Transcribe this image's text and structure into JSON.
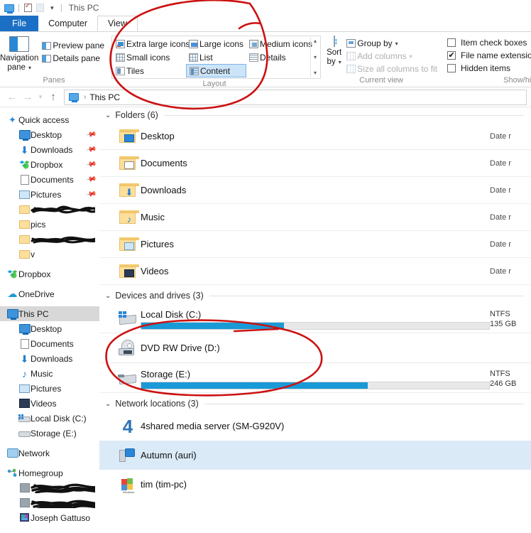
{
  "window": {
    "title": "This PC",
    "icon": "computer-icon",
    "quick_access_toolbar": [
      "properties-icon",
      "new-folder-icon",
      "customize-caret"
    ]
  },
  "ribbon": {
    "tabs": [
      {
        "label": "File",
        "type": "file"
      },
      {
        "label": "Computer",
        "type": "normal"
      },
      {
        "label": "View",
        "type": "active"
      }
    ],
    "groups": [
      {
        "name": "Panes",
        "label": "Panes",
        "big_button": {
          "label_line1": "Navigation",
          "label_line2": "pane",
          "caret": "▾",
          "icon": "navigation-pane-icon"
        },
        "small_buttons": [
          {
            "label": "Preview pane",
            "icon": "preview-pane-icon",
            "disabled": false
          },
          {
            "label": "Details pane",
            "icon": "details-pane-icon",
            "disabled": false
          }
        ]
      },
      {
        "name": "Layout",
        "label": "Layout",
        "gallery": [
          {
            "label": "Extra large icons",
            "icon": "extra-large-icons-icon",
            "selected": false
          },
          {
            "label": "Large icons",
            "icon": "large-icons-icon",
            "selected": false
          },
          {
            "label": "Medium icons",
            "icon": "medium-icons-icon",
            "selected": false
          },
          {
            "label": "Small icons",
            "icon": "small-icons-icon",
            "selected": false
          },
          {
            "label": "List",
            "icon": "list-view-icon",
            "selected": false
          },
          {
            "label": "Details",
            "icon": "details-view-icon",
            "selected": false
          },
          {
            "label": "Tiles",
            "icon": "tiles-view-icon",
            "selected": false
          },
          {
            "label": "Content",
            "icon": "content-view-icon",
            "selected": true
          }
        ],
        "scroll": {
          "up": "▴",
          "down": "▾",
          "more": "▾"
        }
      },
      {
        "name": "Current view",
        "label": "Current view",
        "big_button": {
          "label_line1": "Sort",
          "label_line2": "by",
          "caret": "▾",
          "icon": "sort-by-icon"
        },
        "small_buttons": [
          {
            "label": "Group by",
            "icon": "group-by-icon",
            "caret": "▾",
            "disabled": false
          },
          {
            "label": "Add columns",
            "icon": "add-columns-icon",
            "caret": "▾",
            "disabled": true
          },
          {
            "label": "Size all columns to fit",
            "icon": "size-columns-icon",
            "disabled": true
          }
        ]
      },
      {
        "name": "Show/hide",
        "label": "Show/hid",
        "checkboxes": [
          {
            "label": "Item check boxes",
            "checked": false
          },
          {
            "label": "File name extension",
            "checked": true
          },
          {
            "label": "Hidden items",
            "checked": false
          }
        ]
      }
    ]
  },
  "addressbar": {
    "back": "←",
    "forward": "→",
    "recent": "▾",
    "up": "↑",
    "breadcrumb_icon": "computer-icon",
    "separator": "›",
    "path": "This PC"
  },
  "sidebar": {
    "items": [
      {
        "label": "Quick access",
        "icon": "quick-access-star-icon",
        "indent": 0,
        "pinned": false
      },
      {
        "label": "Desktop",
        "icon": "desktop-monitor-icon",
        "indent": 1,
        "pinned": true
      },
      {
        "label": "Downloads",
        "icon": "downloads-arrow-icon",
        "indent": 1,
        "pinned": true
      },
      {
        "label": "Dropbox",
        "icon": "dropbox-icon",
        "indent": 1,
        "pinned": true
      },
      {
        "label": "Documents",
        "icon": "documents-icon",
        "indent": 1,
        "pinned": true
      },
      {
        "label": "Pictures",
        "icon": "pictures-icon",
        "indent": 1,
        "pinned": true
      },
      {
        "label": "",
        "icon": "folder-icon",
        "indent": 1,
        "redacted": true
      },
      {
        "label": "pics",
        "icon": "folder-icon",
        "indent": 1
      },
      {
        "label": "",
        "icon": "folder-icon",
        "indent": 1,
        "redacted": true
      },
      {
        "label": "v",
        "icon": "folder-icon",
        "indent": 1
      },
      {
        "label": "Dropbox",
        "icon": "dropbox-icon",
        "indent": 0,
        "spacer_before": true
      },
      {
        "label": "OneDrive",
        "icon": "onedrive-cloud-icon",
        "indent": 0,
        "spacer_before": true
      },
      {
        "label": "This PC",
        "icon": "this-pc-icon",
        "indent": 0,
        "selected": true,
        "spacer_before": true
      },
      {
        "label": "Desktop",
        "icon": "desktop-monitor-icon",
        "indent": 1
      },
      {
        "label": "Documents",
        "icon": "documents-icon",
        "indent": 1
      },
      {
        "label": "Downloads",
        "icon": "downloads-arrow-icon",
        "indent": 1
      },
      {
        "label": "Music",
        "icon": "music-note-icon",
        "indent": 1
      },
      {
        "label": "Pictures",
        "icon": "pictures-icon",
        "indent": 1
      },
      {
        "label": "Videos",
        "icon": "videos-icon",
        "indent": 1
      },
      {
        "label": "Local Disk (C:)",
        "icon": "hard-drive-icon",
        "indent": 1
      },
      {
        "label": "Storage (E:)",
        "icon": "hard-drive-icon",
        "indent": 1
      },
      {
        "label": "Network",
        "icon": "network-icon",
        "indent": 0,
        "spacer_before": true
      },
      {
        "label": "Homegroup",
        "icon": "homegroup-icon",
        "indent": 0,
        "spacer_before": true
      },
      {
        "label": "",
        "icon": "user-icon",
        "indent": 1,
        "redacted": true
      },
      {
        "label": "",
        "icon": "user-icon",
        "indent": 1,
        "redacted": true
      },
      {
        "label": "Joseph Gattuso",
        "icon": "user-icon",
        "indent": 1
      }
    ]
  },
  "main": {
    "groups": [
      {
        "header": "Folders (6)",
        "chevron": "⌄",
        "type": "folders",
        "items": [
          {
            "name": "Desktop",
            "icon": "folder-desktop-icon",
            "meta": "Date r"
          },
          {
            "name": "Documents",
            "icon": "folder-documents-icon",
            "meta": "Date r"
          },
          {
            "name": "Downloads",
            "icon": "folder-downloads-icon",
            "meta": "Date r"
          },
          {
            "name": "Music",
            "icon": "folder-music-icon",
            "meta": "Date r"
          },
          {
            "name": "Pictures",
            "icon": "folder-pictures-icon",
            "meta": "Date r"
          },
          {
            "name": "Videos",
            "icon": "folder-videos-icon",
            "meta": "Date r"
          }
        ]
      },
      {
        "header": "Devices and drives (3)",
        "chevron": "⌄",
        "type": "drives",
        "items": [
          {
            "name": "Local Disk (C:)",
            "icon": "local-disk-icon",
            "has_bar": true,
            "fill_percent": 41,
            "fs": "NTFS",
            "free": "135 GB"
          },
          {
            "name": "DVD RW Drive (D:)",
            "icon": "dvd-drive-icon",
            "has_bar": false,
            "fs": "",
            "free": ""
          },
          {
            "name": "Storage (E:)",
            "icon": "storage-drive-icon",
            "has_bar": true,
            "fill_percent": 65,
            "fs": "NTFS",
            "free": "246 GB"
          }
        ]
      },
      {
        "header": "Network locations (3)",
        "chevron": "⌄",
        "type": "network",
        "items": [
          {
            "name": "4shared media server (SM-G920V)",
            "icon": "4shared-icon",
            "selected": false
          },
          {
            "name": "Autumn (auri)",
            "icon": "network-pc-icon",
            "selected": true
          },
          {
            "name": "tim (tim-pc)",
            "icon": "windows-media-player-icon",
            "selected": false
          }
        ]
      }
    ]
  },
  "annotations": {
    "color": "#cc1111",
    "marks": [
      {
        "name": "layout-group-circle",
        "shape": "ellipse"
      },
      {
        "name": "drives-circle",
        "shape": "ellipse"
      },
      {
        "name": "drives-underline",
        "shape": "line"
      }
    ]
  }
}
